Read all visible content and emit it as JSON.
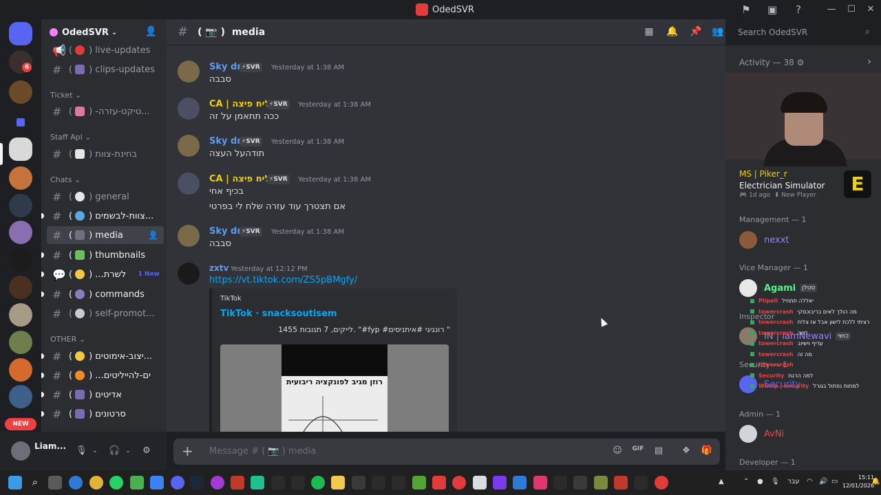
{
  "window": {
    "title": "OdedSVR"
  },
  "server": {
    "name": "OdedSVR",
    "new_label": "NEW",
    "dm_badge": "6"
  },
  "sidebar": {
    "items": [
      {
        "label": "live-updates",
        "category": null
      },
      {
        "label": "clips-updates",
        "category": null
      },
      {
        "label": "-טיקט-עזרה...",
        "category": "Ticket"
      },
      {
        "label": "בחינת-צוות",
        "category": "Staff Apl"
      },
      {
        "label": "general",
        "category": "Chats"
      },
      {
        "label": "צוות-לבשמים...",
        "category": null
      },
      {
        "label": "media",
        "category": null,
        "active": true
      },
      {
        "label": "thumbnails",
        "category": null
      },
      {
        "label": "...לשרת",
        "category": null,
        "badge": "1 New"
      },
      {
        "label": "commands",
        "category": null
      },
      {
        "label": "self-promot...",
        "category": null
      },
      {
        "label": "יצוב-אימוטים...",
        "category": "OTHER"
      },
      {
        "label": "...ים-להייליטים",
        "category": null
      },
      {
        "label": "אדיטים",
        "category": null
      },
      {
        "label": "סרטונים",
        "category": null
      }
    ],
    "categories": {
      "ticket": "Ticket",
      "staff": "Staff Apl",
      "chats": "Chats",
      "other": "OTHER"
    },
    "new_badge": "1 New"
  },
  "user": {
    "name": "Liam..."
  },
  "channel": {
    "name": "media",
    "prefix": "( 📷 )"
  },
  "search": {
    "placeholder": "Search OdedSVR"
  },
  "messages": [
    {
      "author": "Sky dnl",
      "tag": "⚡SVR",
      "time": "Yesterday at 1:38 AM",
      "lines": [
        "סבבה"
      ]
    },
    {
      "author": "CA | שליח פיצה",
      "tag": "⚡SVR",
      "time": "Yesterday at 1:38 AM",
      "lines": [
        "ככה תתאמן על זה"
      ]
    },
    {
      "author": "Sky dnl",
      "tag": "⚡SVR",
      "time": "Yesterday at 1:38 AM",
      "lines": [
        "תודהעל העצה"
      ]
    },
    {
      "author": "CA | שליח פיצה",
      "tag": "⚡SVR",
      "time": "Yesterday at 1:38 AM",
      "lines": [
        "בכיף אחי",
        "אם תצטרך עוד עזרה שלח לי בפרטי"
      ]
    },
    {
      "author": "Sky dnl",
      "tag": "⚡SVR",
      "time": "Yesterday at 1:38 AM",
      "lines": [
        "סבבה"
      ]
    },
    {
      "author": "zxtv",
      "tag": "",
      "time": "Yesterday at 12:12 PM",
      "lines": [
        "https://vt.tiktok.com/ZS5pBMgfy/"
      ]
    }
  ],
  "embed": {
    "provider": "TikTok",
    "title": "TikTok · snacksoutisem",
    "description": "1455 לייקים, 7 תגובות. \"#fyp #רונגיגי #איתניסים \"",
    "image_text": "רוזן מגיב לפונקציה ריבועית"
  },
  "composer": {
    "placeholder": "Message # ( 📷 ) media"
  },
  "activity": {
    "heading": "Activity — 38",
    "stream_user": "MS | Piker_r",
    "game": "Electrician Simulator",
    "meta_time": "1d ago",
    "meta_role": "New Player",
    "game_icon_letter": "E"
  },
  "members": {
    "roles": [
      {
        "name": "Management — 1",
        "members": [
          "nexxt"
        ]
      },
      {
        "name": "Vice Manager — 1",
        "members": [
          "Agami"
        ]
      },
      {
        "name": "Inspector",
        "members": [
          "IN | IamNewavi"
        ]
      },
      {
        "name": "Security — 1",
        "members": [
          "Security"
        ]
      },
      {
        "name": "Admin — 1",
        "members": [
          "AvNi"
        ]
      },
      {
        "name": "Developer — 1",
        "members": []
      }
    ],
    "vice_tag": "סטלן",
    "inspector_tag": "כושי",
    "colors": {
      "nexxt": "#9b84ec",
      "agami": "#57f287",
      "inspector": "#9b84ec",
      "security": "#5865f2",
      "avni": "#ed4245"
    }
  },
  "overlay": [
    {
      "name": "Plipell",
      "text": "יאללה תתחיל"
    },
    {
      "name": "towercrash",
      "text": "מה הולך לאים בריבוכסקי"
    },
    {
      "name": "towercrash",
      "text": "רציתי ללכת לישון אבל אז צליח"
    },
    {
      "name": "towercrash",
      "text": "למה"
    },
    {
      "name": "towercrash",
      "text": "עדיף וישיוב"
    },
    {
      "name": "towercrash",
      "text": "מה זה"
    },
    {
      "name": "towercrash",
      "text": ""
    },
    {
      "name": "Security",
      "text": "למה הרגת"
    },
    {
      "name": "Whelp | security",
      "text": "למחות נפתול בגורל"
    }
  ],
  "taskbar": {
    "time": "15:11",
    "date": "12/01/2026",
    "lang": "עבר"
  }
}
